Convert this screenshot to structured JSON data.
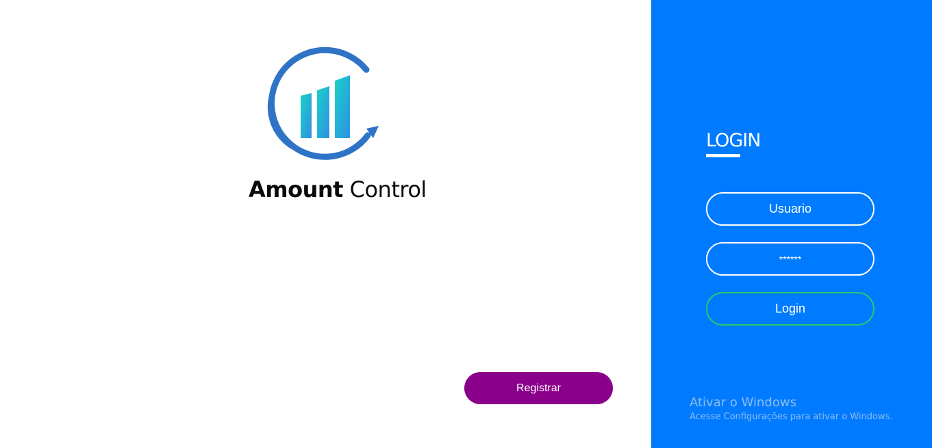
{
  "brand": {
    "name_bold": "Amount",
    "name_regular": " Control",
    "logo_icon": "growth-chart-icon",
    "ring_color": "#2f73c7",
    "bar_gradient": [
      "#19d3c5",
      "#2f8fe6"
    ]
  },
  "register": {
    "label": "Registrar",
    "color": "#8b008b"
  },
  "login_panel": {
    "background": "#007bff",
    "title": "LOGIN",
    "username_placeholder": "Usuario",
    "password_value": "******",
    "submit_label": "Login",
    "submit_border": "#28c76f"
  },
  "watermark": {
    "title": "Ativar o Windows",
    "subtitle": "Acesse Configurações para ativar o Windows."
  }
}
